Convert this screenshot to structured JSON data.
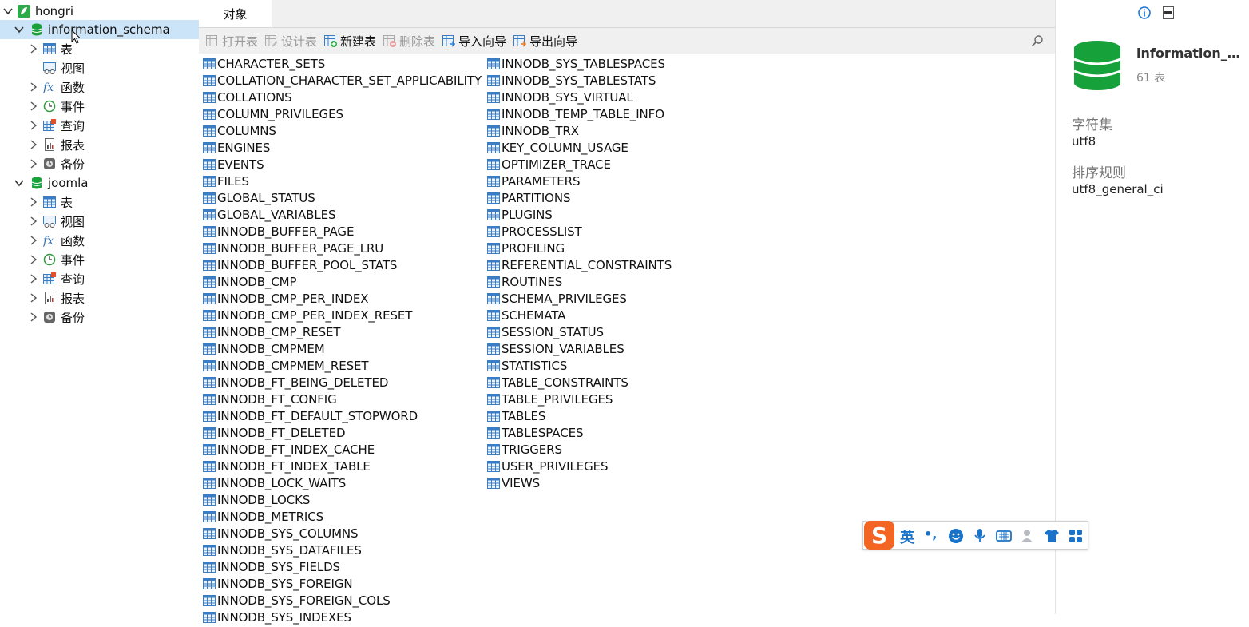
{
  "tree": {
    "connection": "hongri",
    "databases": [
      {
        "name": "information_schema",
        "children": [
          "表",
          "视图",
          "函数",
          "事件",
          "查询",
          "报表",
          "备份"
        ]
      },
      {
        "name": "joomla",
        "children": [
          "表",
          "视图",
          "函数",
          "事件",
          "查询",
          "报表",
          "备份"
        ]
      }
    ]
  },
  "tabs": {
    "objects": "对象"
  },
  "toolbar": {
    "open_table": "打开表",
    "design_table": "设计表",
    "new_table": "新建表",
    "delete_table": "删除表",
    "import_wizard": "导入向导",
    "export_wizard": "导出向导"
  },
  "tables_col1": [
    "CHARACTER_SETS",
    "COLLATION_CHARACTER_SET_APPLICABILITY",
    "COLLATIONS",
    "COLUMN_PRIVILEGES",
    "COLUMNS",
    "ENGINES",
    "EVENTS",
    "FILES",
    "GLOBAL_STATUS",
    "GLOBAL_VARIABLES",
    "INNODB_BUFFER_PAGE",
    "INNODB_BUFFER_PAGE_LRU",
    "INNODB_BUFFER_POOL_STATS",
    "INNODB_CMP",
    "INNODB_CMP_PER_INDEX",
    "INNODB_CMP_PER_INDEX_RESET",
    "INNODB_CMP_RESET",
    "INNODB_CMPMEM",
    "INNODB_CMPMEM_RESET",
    "INNODB_FT_BEING_DELETED",
    "INNODB_FT_CONFIG",
    "INNODB_FT_DEFAULT_STOPWORD",
    "INNODB_FT_DELETED",
    "INNODB_FT_INDEX_CACHE",
    "INNODB_FT_INDEX_TABLE",
    "INNODB_LOCK_WAITS",
    "INNODB_LOCKS",
    "INNODB_METRICS",
    "INNODB_SYS_COLUMNS",
    "INNODB_SYS_DATAFILES",
    "INNODB_SYS_FIELDS",
    "INNODB_SYS_FOREIGN",
    "INNODB_SYS_FOREIGN_COLS",
    "INNODB_SYS_INDEXES"
  ],
  "tables_col2": [
    "INNODB_SYS_TABLESPACES",
    "INNODB_SYS_TABLESTATS",
    "INNODB_SYS_VIRTUAL",
    "INNODB_TEMP_TABLE_INFO",
    "INNODB_TRX",
    "KEY_COLUMN_USAGE",
    "OPTIMIZER_TRACE",
    "PARAMETERS",
    "PARTITIONS",
    "PLUGINS",
    "PROCESSLIST",
    "PROFILING",
    "REFERENTIAL_CONSTRAINTS",
    "ROUTINES",
    "SCHEMA_PRIVILEGES",
    "SCHEMATA",
    "SESSION_STATUS",
    "SESSION_VARIABLES",
    "STATISTICS",
    "TABLE_CONSTRAINTS",
    "TABLE_PRIVILEGES",
    "TABLES",
    "TABLESPACES",
    "TRIGGERS",
    "USER_PRIVILEGES",
    "VIEWS"
  ],
  "info": {
    "db_name": "information_sc...",
    "table_count": "61 表",
    "charset_label": "字符集",
    "charset_value": "utf8",
    "collation_label": "排序规则",
    "collation_value": "utf8_general_ci"
  },
  "ime": {
    "lang": "英",
    "punct": "•,"
  },
  "colors": {
    "selection": "#cce4f7",
    "db_green": "#1aa23a",
    "table_blue": "#3b7dc4",
    "ime_orange": "#f26522"
  }
}
